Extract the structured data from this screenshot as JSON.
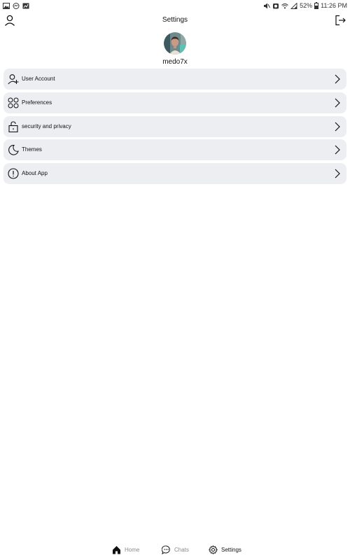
{
  "status_bar": {
    "battery": "52%",
    "time": "11:26 PM",
    "left_icons": [
      "image-icon",
      "messenger-icon",
      "chart-icon"
    ],
    "right_icons": [
      "mute-icon",
      "alarm-icon",
      "wifi-icon",
      "signal-icon",
      "battery-icon"
    ]
  },
  "header": {
    "title": "Settings",
    "left_icon": "user-icon",
    "right_icon": "logout-icon"
  },
  "profile": {
    "username": "medo7x",
    "avatar_icon": "avatar"
  },
  "menu": {
    "items": [
      {
        "label": "User Account",
        "icon": "user-add-icon"
      },
      {
        "label": "Preferences",
        "icon": "grid-circles-icon"
      },
      {
        "label": "security and privacy",
        "icon": "lock-icon"
      },
      {
        "label": "Themes",
        "icon": "moon-icon"
      },
      {
        "label": "About App",
        "icon": "info-icon"
      }
    ],
    "chevron_icon": "chevron-right-icon"
  },
  "bottom_nav": {
    "items": [
      {
        "label": "Home",
        "icon": "home-icon",
        "active": false
      },
      {
        "label": "Chats",
        "icon": "chat-icon",
        "active": false
      },
      {
        "label": "Settings",
        "icon": "gear-icon",
        "active": true
      }
    ]
  },
  "colors": {
    "background": "#ffffff",
    "row_background": "#eceef1",
    "text": "#111111",
    "inactive_nav": "#8a8a8a"
  }
}
